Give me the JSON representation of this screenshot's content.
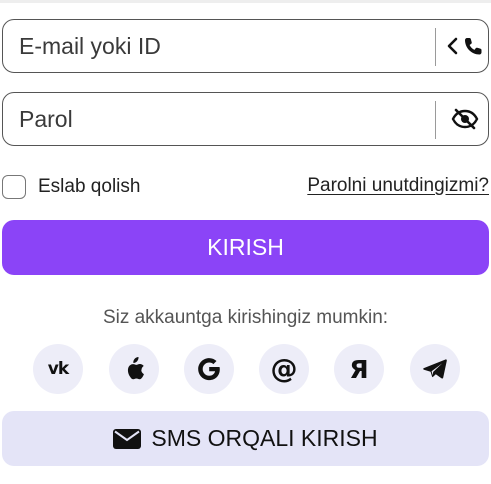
{
  "login_form": {
    "email_field": {
      "placeholder": "E-mail yoki ID",
      "value": "",
      "toggle_icon": "chevron-phone-icon"
    },
    "password_field": {
      "placeholder": "Parol",
      "value": "",
      "toggle_icon": "eye-slash-icon"
    },
    "remember_label": "Eslab qolish",
    "remember_checked": false,
    "forgot_link": "Parolni unutdingizmi?",
    "submit_label": "KIRISH"
  },
  "social": {
    "caption": "Siz akkauntga kirishingiz mumkin:",
    "providers": [
      {
        "name": "vk",
        "icon": "vk-icon"
      },
      {
        "name": "apple",
        "icon": "apple-icon"
      },
      {
        "name": "google",
        "icon": "google-icon"
      },
      {
        "name": "mail",
        "icon": "at-sign-icon"
      },
      {
        "name": "yandex",
        "icon": "yandex-icon"
      },
      {
        "name": "telegram",
        "icon": "telegram-icon"
      }
    ]
  },
  "sms_login": {
    "label": "SMS ORQALI KIRISH",
    "icon": "envelope-icon"
  },
  "colors": {
    "primary": "#8b44f7",
    "secondary_bg": "#e4e4f7",
    "social_bg": "#ededf8",
    "text": "#222222",
    "border": "#555555"
  }
}
